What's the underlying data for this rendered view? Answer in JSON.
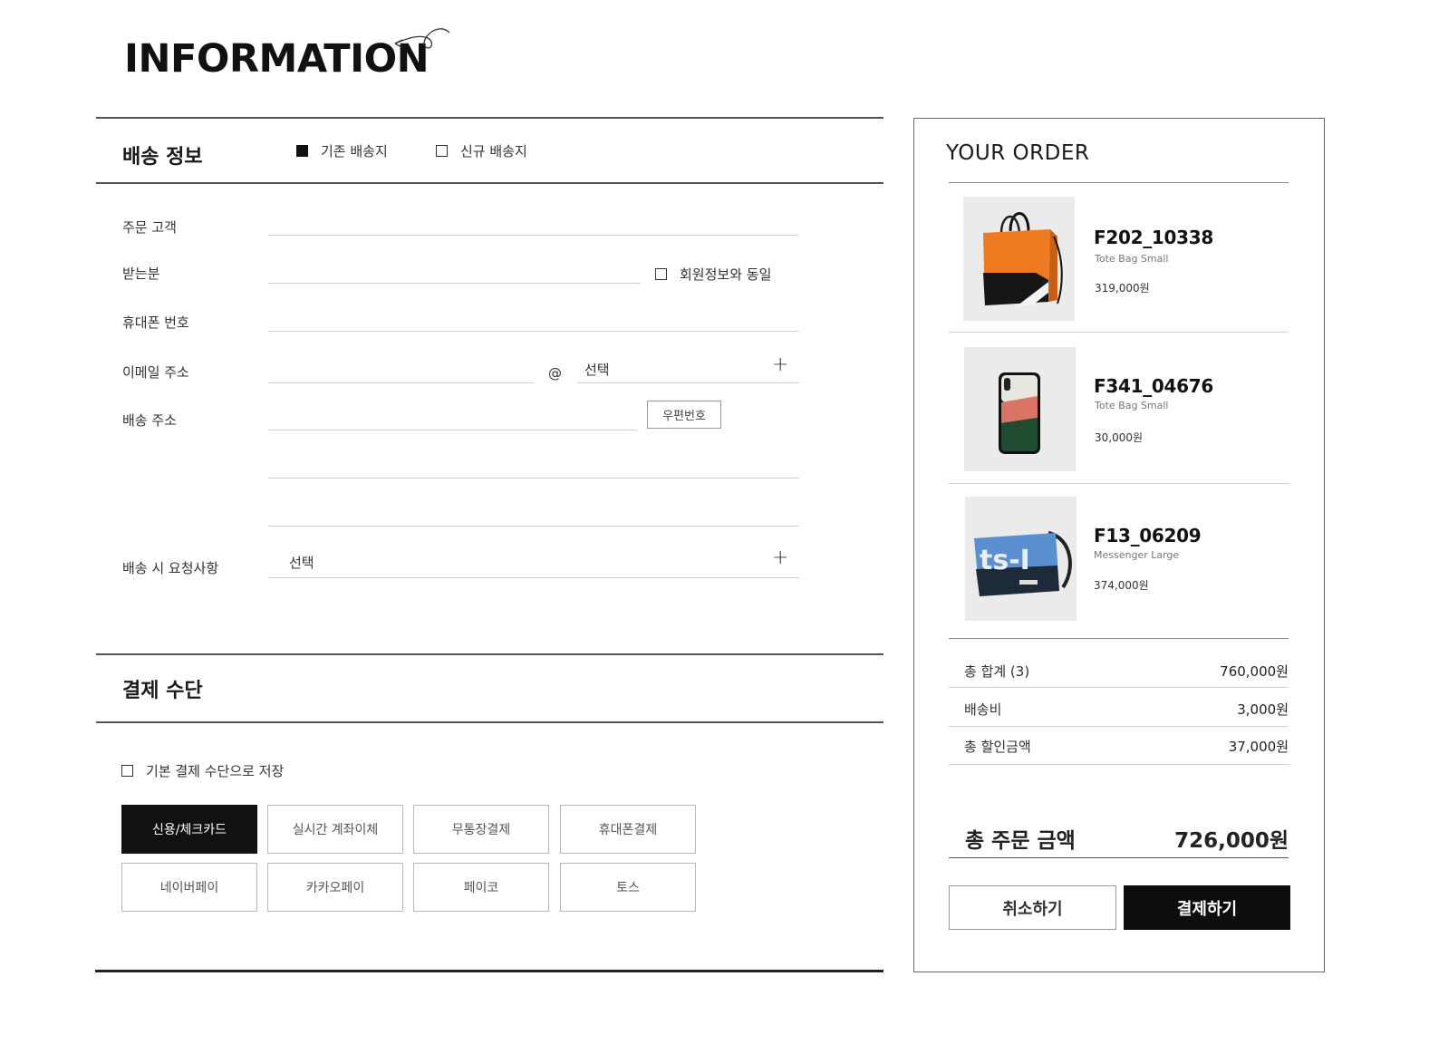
{
  "header": {
    "title": "INFORMATION"
  },
  "shipping": {
    "title": "배송 정보",
    "option_existing": "기존 배송지",
    "option_new": "신규 배송지",
    "fields": {
      "customer_label": "주문 고객",
      "recipient_label": "받는분",
      "same_as_member": "회원정보와 동일",
      "phone_label": "휴대폰 번호",
      "email_label": "이메일 주소",
      "email_at": "@",
      "email_domain_select": "선택",
      "address_label": "배송 주소",
      "postcode_button": "우편번호",
      "request_label": "배송 시 요청사항",
      "request_select": "선택"
    }
  },
  "payment": {
    "title": "결제 수단",
    "save_default": "기본 결제 수단으로 저장",
    "methods": [
      "신용/체크카드",
      "실시간 계좌이체",
      "무통장결제",
      "휴대폰결제",
      "네이버페이",
      "카카오페이",
      "페이코",
      "토스"
    ],
    "selected": "신용/체크카드"
  },
  "order": {
    "title": "YOUR ORDER",
    "items": [
      {
        "code": "F202_10338",
        "name": "Tote Bag Small",
        "price": "319,000원",
        "image_icon": "orange-tote-bag-icon"
      },
      {
        "code": "F341_04676",
        "name": "Tote Bag Small",
        "price": "30,000원",
        "image_icon": "phone-case-icon"
      },
      {
        "code": "F13_06209",
        "name": "Messenger Large",
        "price": "374,000원",
        "image_icon": "blue-messenger-bag-icon"
      }
    ],
    "summary": {
      "subtotal_label": "총 합계 (3)",
      "subtotal_value": "760,000원",
      "shipping_label": "배송비",
      "shipping_value": "3,000원",
      "discount_label": "총 할인금액",
      "discount_value": "37,000원"
    },
    "total_label": "총 주문 금액",
    "total_value": "726,000원",
    "cancel_button": "취소하기",
    "checkout_button": "결제하기"
  }
}
